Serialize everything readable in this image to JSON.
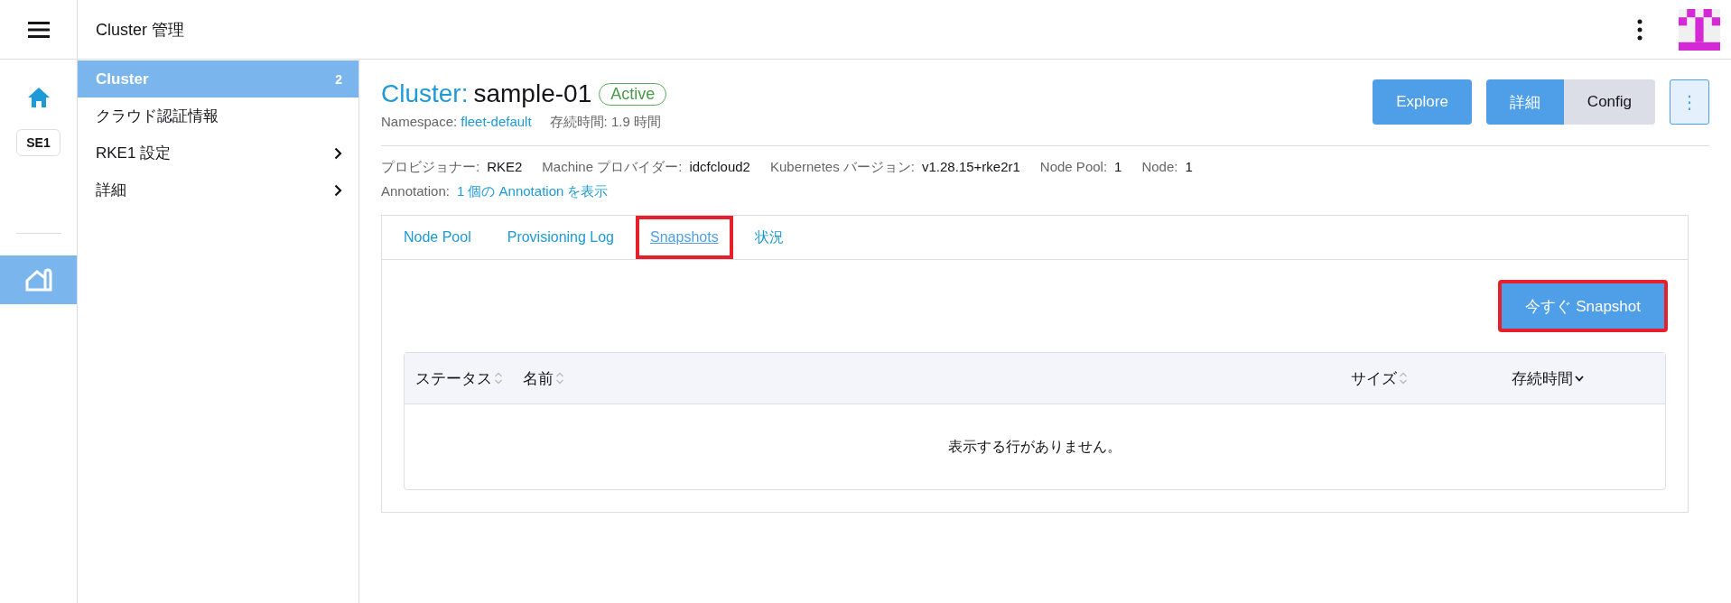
{
  "header": {
    "title": "Cluster 管理"
  },
  "rail": {
    "items": [
      {
        "kind": "home",
        "selected": false
      },
      {
        "kind": "badge",
        "label": "SE1",
        "selected": false
      },
      {
        "kind": "divider"
      },
      {
        "kind": "cluster",
        "selected": true
      }
    ]
  },
  "sidebar": {
    "items": [
      {
        "label": "Cluster",
        "count": "2",
        "selected": true,
        "expandable": false
      },
      {
        "label": "クラウド認証情報",
        "selected": false,
        "expandable": false
      },
      {
        "label": "RKE1 設定",
        "selected": false,
        "expandable": true
      },
      {
        "label": "詳細",
        "selected": false,
        "expandable": true
      }
    ]
  },
  "page": {
    "type_label": "Cluster:",
    "name": "sample-01",
    "state": "Active",
    "namespace_label": "Namespace:",
    "namespace": "fleet-default",
    "age": "存続時間: 1.9 時間",
    "actions": [
      {
        "label": "Explore",
        "kind": "primary"
      },
      {
        "label": "詳細",
        "kind": "toggle",
        "selected": true
      },
      {
        "label": "Config",
        "kind": "toggle",
        "selected": false
      },
      {
        "label": "⋮",
        "kind": "menu"
      }
    ],
    "details": [
      {
        "label": "プロビジョナー:",
        "value": "RKE2"
      },
      {
        "label": "Machine プロバイダー:",
        "value": "idcfcloud2"
      },
      {
        "label": "Kubernetes バージョン:",
        "value": "v1.28.15+rke2r1"
      },
      {
        "label": "Node Pool:",
        "value": "1"
      },
      {
        "label": "Node:",
        "value": "1"
      }
    ],
    "annotation_label": "Annotation:",
    "annotation_link": "1 個の Annotation を表示"
  },
  "tabs": [
    {
      "label": "Node Pool",
      "selected": false,
      "highlighted": false
    },
    {
      "label": "Provisioning Log",
      "selected": false,
      "highlighted": false
    },
    {
      "label": "Snapshots",
      "selected": true,
      "highlighted": true
    },
    {
      "label": "状況",
      "selected": false,
      "highlighted": false
    }
  ],
  "snapshot_button": {
    "label": "今すぐ Snapshot",
    "highlighted": true
  },
  "table": {
    "columns": [
      {
        "label": "ステータス",
        "sorted": false
      },
      {
        "label": "名前",
        "sorted": false
      },
      {
        "label": "サイズ",
        "sorted": false
      },
      {
        "label": "存続時間",
        "sorted": true
      }
    ],
    "empty_message": "表示する行がありません。"
  }
}
